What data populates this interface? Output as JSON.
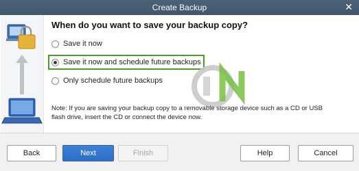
{
  "window": {
    "title": "Create Backup",
    "close_glyph": "✕"
  },
  "question": "When do you want to save your backup copy?",
  "options": [
    {
      "label": "Save it now",
      "checked": false
    },
    {
      "label": "Save it now and schedule future backups",
      "checked": true
    },
    {
      "label": "Only schedule future backups",
      "checked": false
    }
  ],
  "note": "Note: If you are saving your backup copy to a removable storage device such as a CD or USB flash drive, insert the CD or connect the device now.",
  "buttons": {
    "back": "Back",
    "next": "Next",
    "finish": "Finish",
    "help": "Help",
    "cancel": "Cancel"
  },
  "colors": {
    "titlebar": "#4b6277",
    "highlight": "#4c9a2a",
    "primary_button": "#2f6ec8"
  },
  "icons": {
    "left_panel": [
      "computer-icon",
      "lock-icon",
      "arrow-up-icon",
      "laptop-icon"
    ],
    "watermark": "dn-logo-watermark"
  }
}
